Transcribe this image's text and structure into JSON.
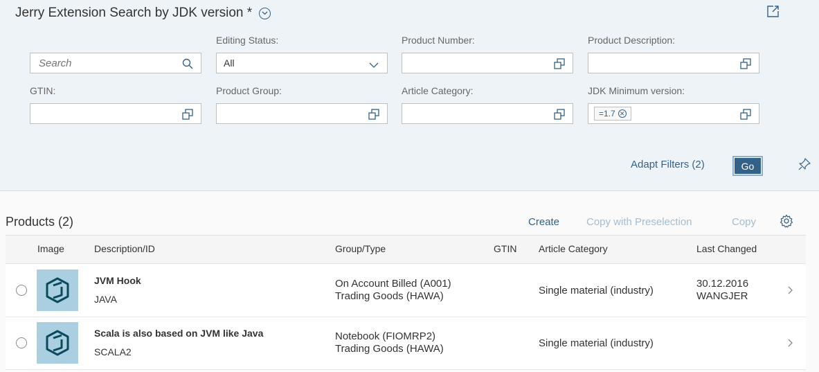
{
  "header": {
    "title": "Jerry Extension Search by JDK version *"
  },
  "filters": {
    "search": {
      "placeholder": "Search"
    },
    "editing_status": {
      "label": "Editing Status:",
      "value": "All"
    },
    "product_number": {
      "label": "Product Number:"
    },
    "product_description": {
      "label": "Product Description:"
    },
    "gtin": {
      "label": "GTIN:"
    },
    "product_group": {
      "label": "Product Group:"
    },
    "article_category": {
      "label": "Article Category:"
    },
    "jdk_min": {
      "label": "JDK Minimum version:",
      "token": "=1.7"
    },
    "adapt_label": "Adapt Filters (2)",
    "go_label": "Go"
  },
  "table": {
    "title": "Products (2)",
    "toolbar": {
      "create": "Create",
      "copy_preselection": "Copy with Preselection",
      "copy": "Copy"
    },
    "columns": {
      "image": "Image",
      "description": "Description/ID",
      "group": "Group/Type",
      "gtin": "GTIN",
      "category": "Article Category",
      "changed": "Last Changed"
    },
    "rows": [
      {
        "description": "JVM Hook",
        "id": "JAVA",
        "group": "On Account Billed (A001)",
        "type": "Trading Goods (HAWA)",
        "category": "Single material (industry)",
        "changed_date": "30.12.2016",
        "changed_by": "WANGJER"
      },
      {
        "description": "Scala is also based on JVM like Java",
        "id": "SCALA2",
        "group": "Notebook (FIOMRP2)",
        "type": "Trading Goods (HAWA)",
        "category": "Single material (industry)",
        "changed_date": "",
        "changed_by": ""
      }
    ]
  },
  "colors": {
    "header_bg": "#edf3f7",
    "accent": "#346187",
    "disabled": "#a6bccf",
    "thumb_bg": "#a9cfe0"
  }
}
